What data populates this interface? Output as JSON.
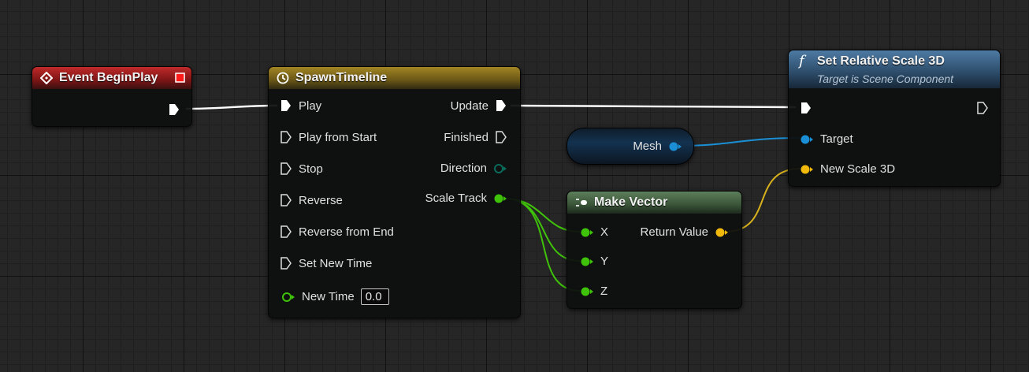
{
  "nodes": {
    "begin_play": {
      "title": "Event BeginPlay"
    },
    "timeline": {
      "title": "SpawnTimeline",
      "inputs": [
        "Play",
        "Play from Start",
        "Stop",
        "Reverse",
        "Reverse from End",
        "Set New Time"
      ],
      "new_time_label": "New Time",
      "new_time_value": "0.0",
      "outputs": {
        "update": "Update",
        "finished": "Finished",
        "direction": "Direction",
        "scale_track": "Scale Track"
      }
    },
    "mesh": {
      "label": "Mesh"
    },
    "make_vector": {
      "title": "Make Vector",
      "x": "X",
      "y": "Y",
      "z": "Z",
      "return_value": "Return Value"
    },
    "set_scale": {
      "title": "Set Relative Scale 3D",
      "subtitle": "Target is Scene Component",
      "target": "Target",
      "new_scale": "New Scale 3D"
    }
  },
  "colors": {
    "exec_wire": "#ffffff",
    "object_wire": "#1a8fd6",
    "float_wire": "#3fc20a",
    "vector_wire": "#d8b21c",
    "event_header": "#a51c1c",
    "timeline_header": "#7a6519",
    "function_header": "#3c5f80",
    "pure_header": "#4b6e4b"
  }
}
